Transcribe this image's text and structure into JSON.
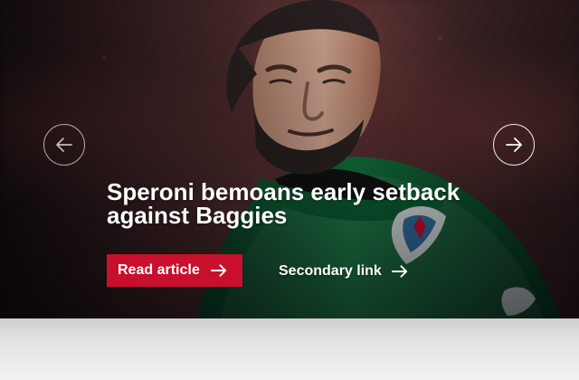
{
  "hero": {
    "headline": "Speroni bemoans early setback against Baggies",
    "image_name": "goalkeeper-hero-image",
    "colors": {
      "accent": "#c8102e",
      "shirt": "#0f6f3e",
      "background": "#3a2021"
    }
  },
  "navigation": {
    "previous_icon": "arrow-left-icon",
    "next_icon": "arrow-right-icon"
  },
  "actions": {
    "primary_label": "Read article",
    "secondary_label": "Secondary link",
    "arrow_icon": "arrow-right-icon"
  }
}
